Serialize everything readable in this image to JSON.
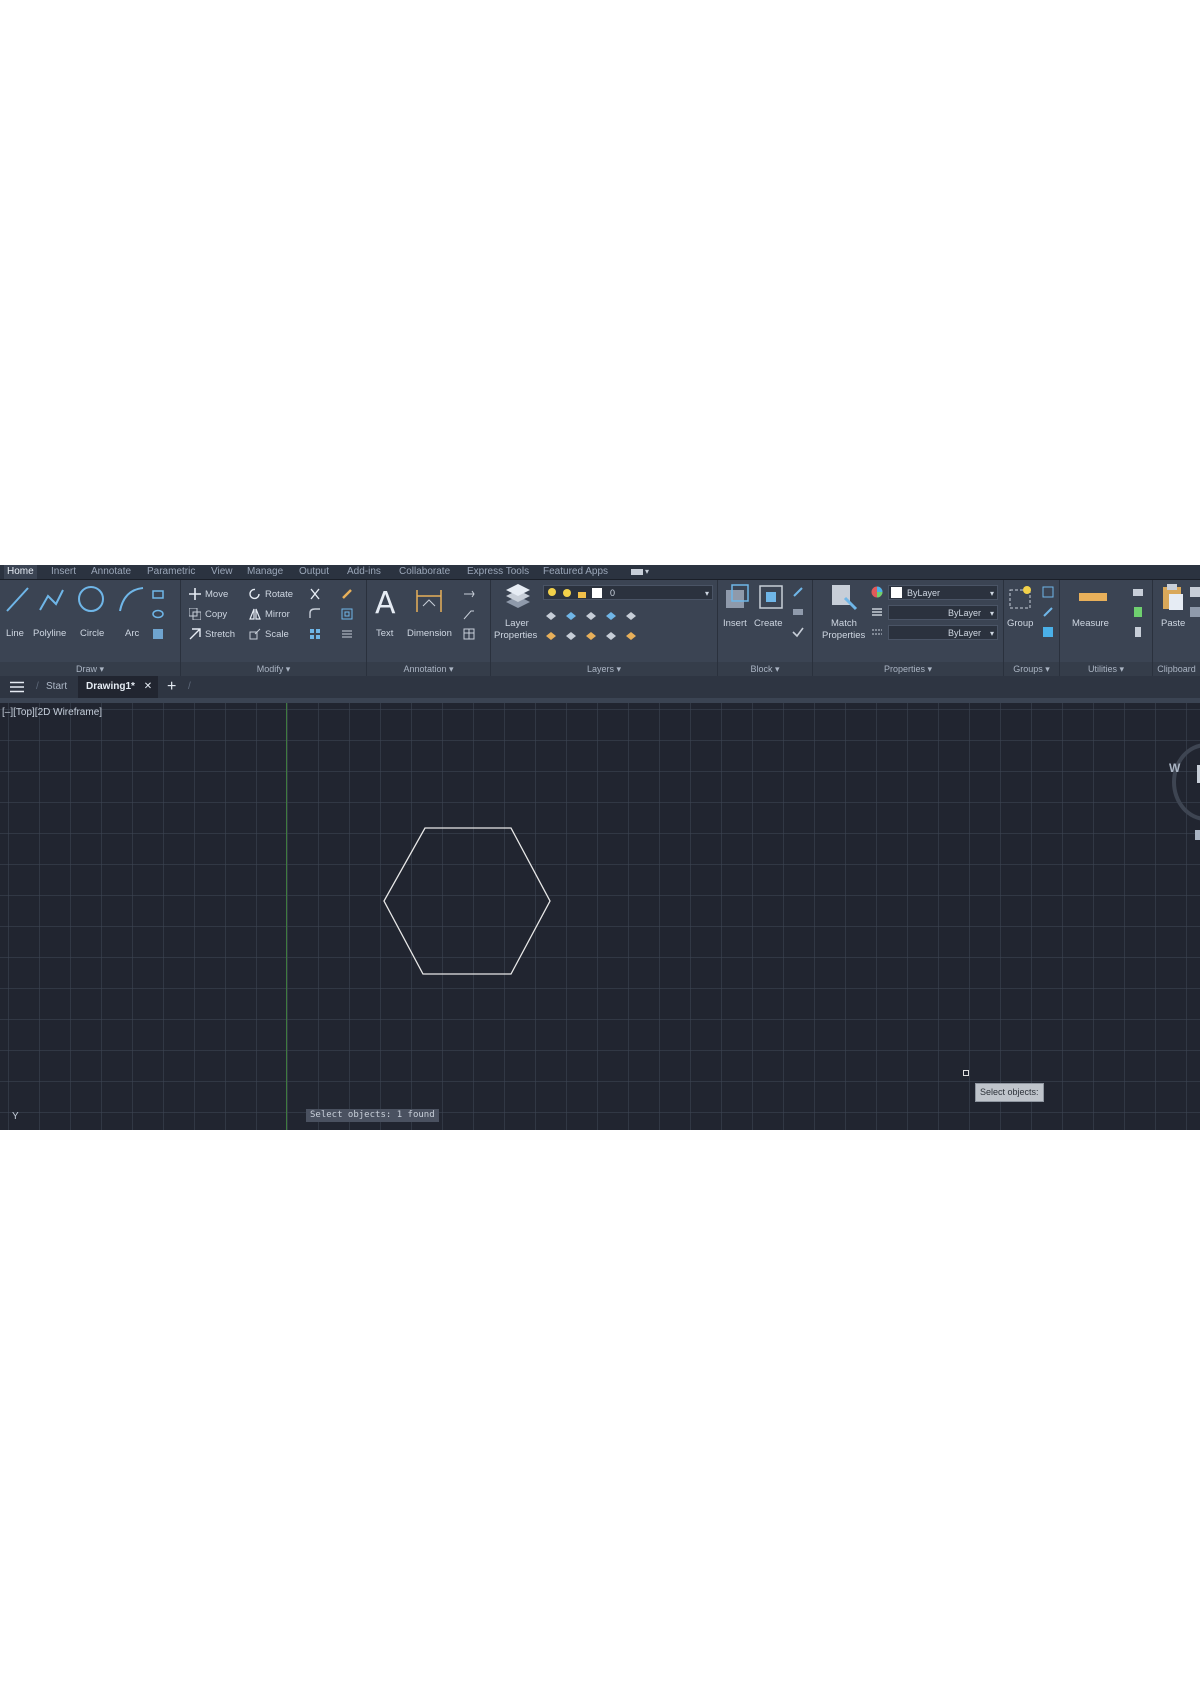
{
  "ribbon": {
    "tabs": [
      "Home",
      "Insert",
      "Annotate",
      "Parametric",
      "View",
      "Manage",
      "Output",
      "Add-ins",
      "Collaborate",
      "Express Tools",
      "Featured Apps"
    ],
    "draw": {
      "title": "Draw ▾",
      "line": "Line",
      "polyline": "Polyline",
      "circle": "Circle",
      "arc": "Arc"
    },
    "modify": {
      "title": "Modify ▾",
      "move": "Move",
      "rotate": "Rotate",
      "copy": "Copy",
      "mirror": "Mirror",
      "stretch": "Stretch",
      "scale": "Scale"
    },
    "annotation": {
      "title": "Annotation ▾",
      "text": "Text",
      "dimension": "Dimension"
    },
    "layers": {
      "title": "Layers ▾",
      "layer_properties_line1": "Layer",
      "layer_properties_line2": "Properties",
      "current_layer": "0"
    },
    "block": {
      "title": "Block ▾",
      "insert": "Insert",
      "create": "Create"
    },
    "properties": {
      "title": "Properties ▾",
      "match_line1": "Match",
      "match_line2": "Properties",
      "color": "ByLayer",
      "linetype": "ByLayer",
      "lineweight": "ByLayer"
    },
    "groups": {
      "title": "Groups ▾",
      "group": "Group"
    },
    "utilities": {
      "title": "Utilities ▾",
      "measure": "Measure"
    },
    "clipboard": {
      "title": "Clipboard",
      "paste": "Paste"
    }
  },
  "file_tabs": {
    "start": "Start",
    "drawing": "Drawing1*"
  },
  "viewport": {
    "label": "[–][Top][2D Wireframe]",
    "y_axis_label": "Y",
    "command_line": "Select objects: 1 found",
    "tooltip": "Select objects:",
    "viewcube_label": "W"
  },
  "colors": {
    "background": "#212530",
    "ribbon": "#3b4453",
    "y_axis": "#3f7a3e",
    "geometry": "#e8e8e8"
  }
}
